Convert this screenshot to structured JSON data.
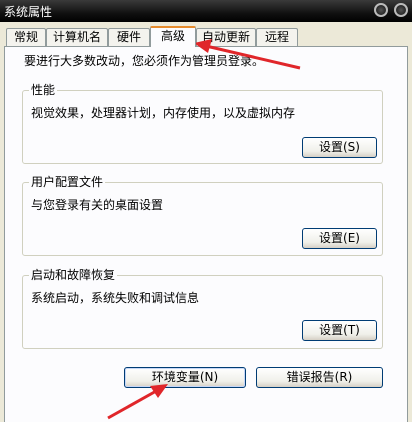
{
  "window": {
    "title": "系统属性"
  },
  "tabs": [
    {
      "label": "常规"
    },
    {
      "label": "计算机名"
    },
    {
      "label": "硬件"
    },
    {
      "label": "高级"
    },
    {
      "label": "自动更新"
    },
    {
      "label": "远程"
    }
  ],
  "admin_note": "要进行大多数改动，您必须作为管理员登录。",
  "groups": {
    "performance": {
      "title": "性能",
      "desc": "视觉效果，处理器计划，内存使用，以及虚拟内存",
      "button": "设置(S)"
    },
    "user_profiles": {
      "title": "用户配置文件",
      "desc": "与您登录有关的桌面设置",
      "button": "设置(E)"
    },
    "startup_recovery": {
      "title": "启动和故障恢复",
      "desc": "系统启动，系统失败和调试信息",
      "button": "设置(T)"
    }
  },
  "buttons": {
    "env_vars": "环境变量(N)",
    "error_report": "错误报告(R)"
  },
  "colors": {
    "arrow": "#e0262a",
    "active_tab_accent": "#e68b2c"
  }
}
